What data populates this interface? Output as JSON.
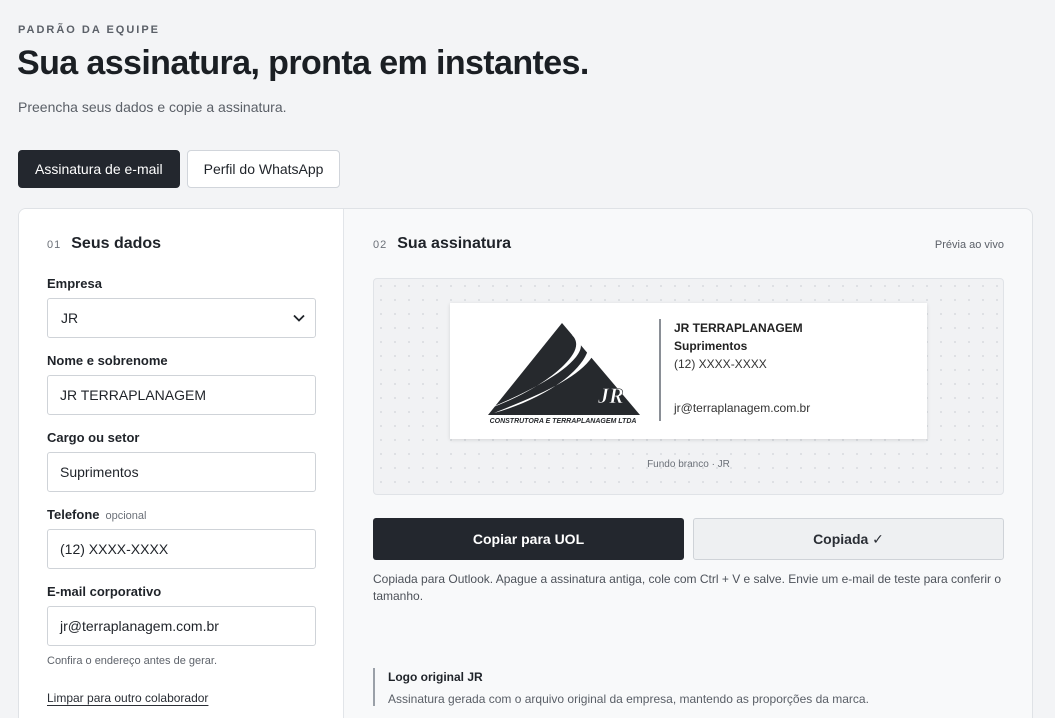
{
  "header": {
    "eyebrow": "PADRÃO DA EQUIPE",
    "title": "Sua assinatura, pronta em instantes.",
    "subtitle": "Preencha seus dados e copie a assinatura."
  },
  "tabs": [
    {
      "label": "Assinatura de e-mail",
      "active": true
    },
    {
      "label": "Perfil do WhatsApp",
      "active": false
    }
  ],
  "form": {
    "section_number": "01",
    "section_title": "Seus dados",
    "company": {
      "label": "Empresa",
      "value": "JR"
    },
    "name": {
      "label": "Nome e sobrenome",
      "value": "JR TERRAPLANAGEM"
    },
    "role": {
      "label": "Cargo ou setor",
      "value": "Suprimentos"
    },
    "phone": {
      "label": "Telefone",
      "optional_tag": "opcional",
      "value": "(12) XXXX-XXXX"
    },
    "email": {
      "label": "E-mail corporativo",
      "value": "jr@terraplanagem.com.br"
    },
    "hint": "Confira o endereço antes de gerar.",
    "clear_link": "Limpar para outro colaborador"
  },
  "preview": {
    "section_number": "02",
    "section_title": "Sua assinatura",
    "live_label": "Prévia ao vivo",
    "signature": {
      "logo_initials": "JR",
      "logo_tagline": "CONSTRUTORA E TERRAPLANAGEM LTDA",
      "name": "JR TERRAPLANAGEM",
      "role": "Suprimentos",
      "phone": "(12) XXXX-XXXX",
      "email": "jr@terraplanagem.com.br"
    },
    "caption": "Fundo branco · JR",
    "copy_button": "Copiar para UOL",
    "copied_button": "Copiada ✓",
    "instructions": "Copiada para Outlook. Apague a assinatura antiga, cole com Ctrl + V e salve. Envie um e-mail de teste para conferir o tamanho.",
    "note_title": "Logo original JR",
    "note_text": "Assinatura gerada com o arquivo original da empresa, mantendo as proporções da marca."
  },
  "colors": {
    "background": "#f3f4f6",
    "primary_dark": "#23272e",
    "border": "#cfd3d8"
  }
}
